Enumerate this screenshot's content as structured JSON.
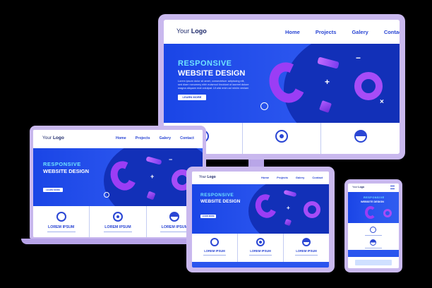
{
  "desktop": {
    "logo_your": "Your",
    "logo_logo": "Logo",
    "nav": [
      "Home",
      "Projects",
      "Galery",
      "Contact"
    ],
    "hero_line1": "RESPONSIVE",
    "hero_line2": "WEBSITE DESIGN",
    "hero_body1": "Lorem ipsum dolor sit amet, consectetuer adipiscing elit,",
    "hero_body2": "sed diam nonummy nibh euismod tincidunt ut laoreet dolore",
    "hero_body3": "magna aliquam erat volutpat. Ut wisi enim ad minim veniam",
    "hero_button": "LEARN MORE"
  },
  "laptop": {
    "logo_your": "Your",
    "logo_logo": "Logo",
    "nav": [
      "Home",
      "Projects",
      "Galery",
      "Contact"
    ],
    "hero_line1": "RESPONSIVE",
    "hero_line2": "WEBSITE DESIGN",
    "hero_button": "LEARN MORE",
    "features": [
      "LOREM IPSUM",
      "LOREM IPSUM",
      "LOREM IPSUM"
    ]
  },
  "tablet": {
    "logo_your": "Your",
    "logo_logo": "Logo",
    "nav": [
      "Home",
      "Projects",
      "Galery",
      "Contact"
    ],
    "hero_line1": "RESPONSIVE",
    "hero_line2": "WEBSITE DESIGN",
    "hero_button": "LEARN MORE",
    "features": [
      "LOREM IPSUM",
      "LOREM IPSUM",
      "LOREM IPSUM"
    ]
  },
  "phone": {
    "logo_your": "Your",
    "logo_logo": "Logo",
    "hero_line1": "RESPONSIVE",
    "hero_line2": "WEBSITE DESIGN"
  },
  "colors": {
    "frame": "#c9b8ee",
    "hero_blue": "#1a45e6",
    "nav_blue": "#2a46d4",
    "accent_cyan": "#6ee3ff",
    "shape_purple": "#8a3cf0"
  }
}
